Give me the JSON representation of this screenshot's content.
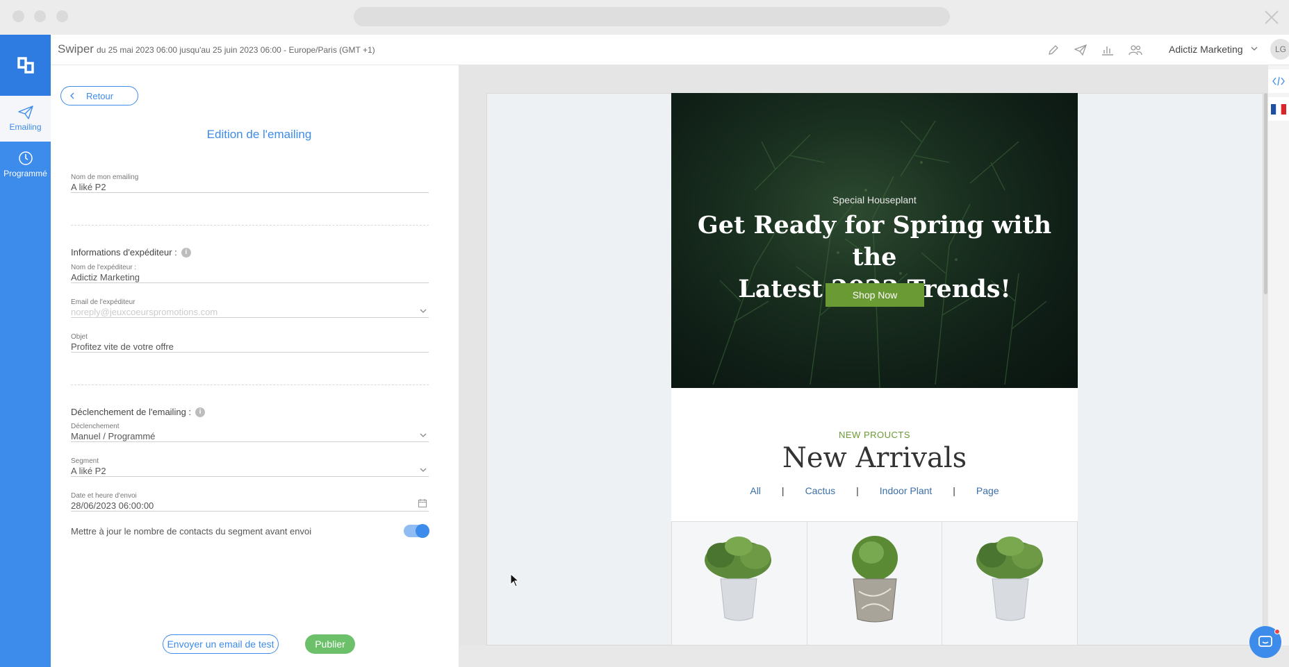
{
  "app": {
    "title": "Swiper",
    "subtitle": "du 25 mai 2023 06:00 jusqu'au 25 juin 2023 06:00 - Europe/Paris (GMT +1)",
    "account_name": "Adictiz Marketing",
    "avatar_initials": "LG"
  },
  "rail": {
    "items": [
      {
        "label": "Emailing",
        "icon": "paper-plane-icon",
        "active": true
      },
      {
        "label": "Programmé",
        "icon": "clock-icon",
        "active": false
      }
    ]
  },
  "header_icons": [
    "pencil-icon",
    "paper-plane-icon",
    "bar-chart-icon",
    "users-icon"
  ],
  "form": {
    "back_label": "Retour",
    "title": "Edition de l'emailing",
    "email_name": {
      "label": "Nom de mon emailing",
      "value": "A liké P2"
    },
    "sender_section": "Informations d'expéditeur :",
    "sender_name": {
      "label": "Nom de l'expéditeur :",
      "value": "Adictiz Marketing"
    },
    "sender_email": {
      "label": "Email de l'expéditeur",
      "value": "noreply@jeuxcoeurspromotions.com"
    },
    "subject": {
      "label": "Objet",
      "value": "Profitez vite de votre offre"
    },
    "trigger_section": "Déclenchement de l'emailing :",
    "trigger": {
      "label": "Déclenchement",
      "value": "Manuel / Programmé"
    },
    "segment": {
      "label": "Segment",
      "value": "A liké P2"
    },
    "send_date": {
      "label": "Date et heure d'envoi",
      "value": "28/06/2023 06:00:00"
    },
    "update_contacts_label": "Mettre à jour le nombre de contacts du segment avant envoi",
    "update_contacts_on": true,
    "test_button": "Envoyer un email de test",
    "publish_button": "Publier"
  },
  "email_preview": {
    "hero_kicker": "Special Houseplant",
    "hero_title_line1": "Get Ready for Spring with the",
    "hero_title_line2": "Latest 2023 Trends!",
    "hero_button": "Shop Now",
    "section_kicker": "NEW PROUCTS",
    "section_title": "New Arrivals",
    "filters": [
      "All",
      "Cactus",
      "Indoor Plant",
      "Page"
    ],
    "filter_separator": "|"
  },
  "colors": {
    "primary": "#3d8bea",
    "publish": "#6cc06a",
    "accent_green": "#6a9a34"
  }
}
